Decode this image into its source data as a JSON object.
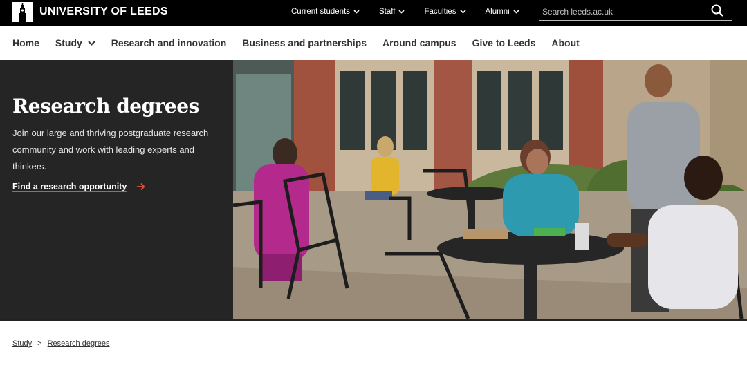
{
  "brand": {
    "name": "UNIVERSITY OF LEEDS"
  },
  "utility_nav": [
    {
      "label": "Current students"
    },
    {
      "label": "Staff"
    },
    {
      "label": "Faculties"
    },
    {
      "label": "Alumni"
    }
  ],
  "search": {
    "placeholder": "Search leeds.ac.uk",
    "icon": "search-icon"
  },
  "main_nav": [
    {
      "label": "Home"
    },
    {
      "label": "Study"
    },
    {
      "label": "Research and innovation"
    },
    {
      "label": "Business and partnerships"
    },
    {
      "label": "Around campus"
    },
    {
      "label": "Give to Leeds"
    },
    {
      "label": "About"
    }
  ],
  "hero": {
    "title": "Research degrees",
    "description": "Join our large and thriving postgraduate research community and work with leading experts and thinkers.",
    "link": "Find a research opportunity",
    "link_color": "#e0503a"
  },
  "breadcrumb": [
    {
      "label": "Study"
    },
    {
      "label": "Research degrees"
    }
  ],
  "breadcrumb_separator": ">"
}
